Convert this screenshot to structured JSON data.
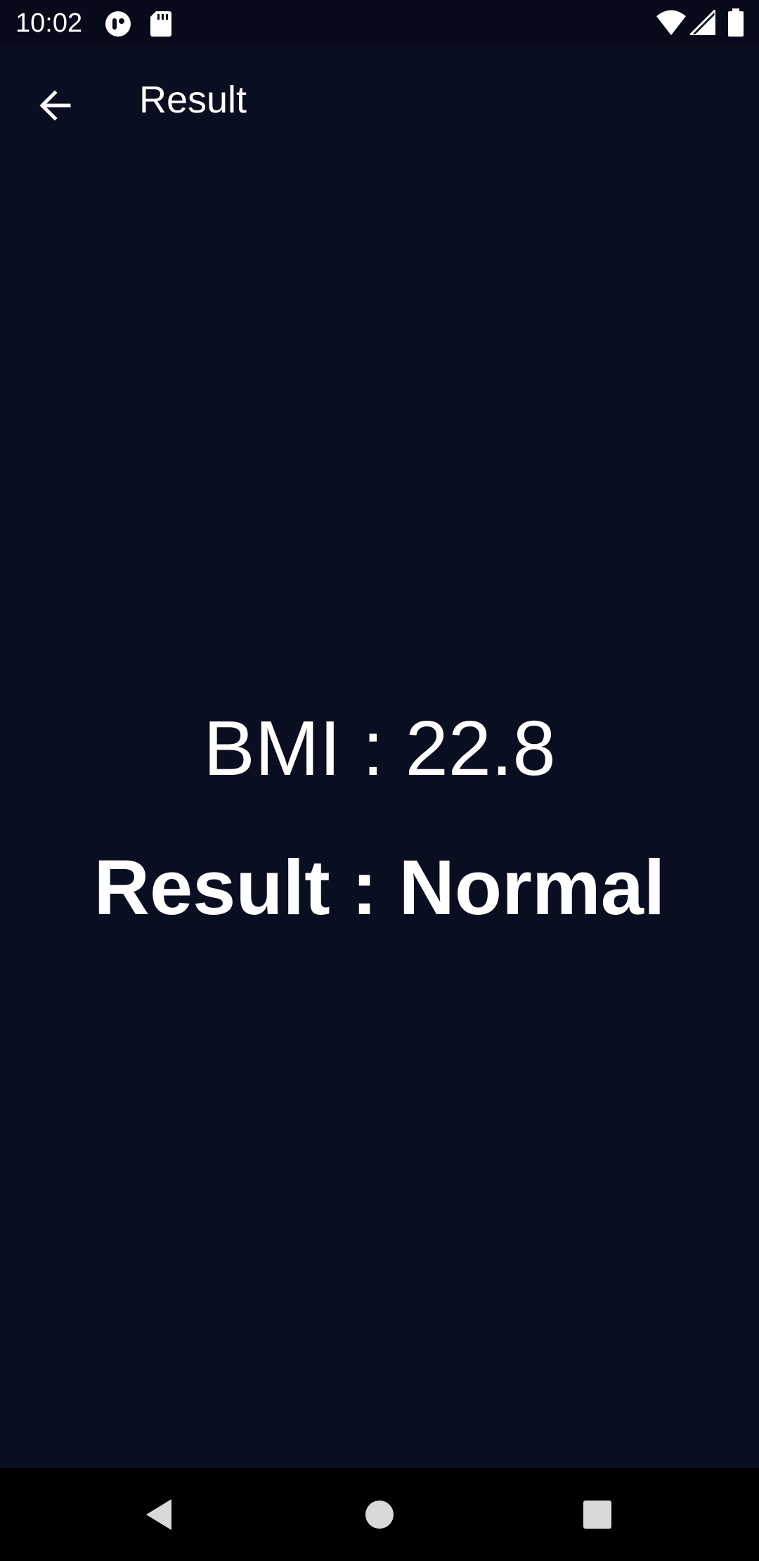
{
  "status_bar": {
    "time": "10:02",
    "icons": [
      "notification-app-icon",
      "sd-card-icon",
      "wifi-icon",
      "signal-icon",
      "battery-icon"
    ]
  },
  "app_bar": {
    "back_icon": "arrow-back-icon",
    "title": "Result"
  },
  "result": {
    "bmi_text": "BMI : 22.8",
    "result_text": "Result : Normal"
  },
  "nav_bar": {
    "icons": [
      "back-triangle-icon",
      "home-circle-icon",
      "recents-square-icon"
    ]
  },
  "colors": {
    "background": "#0a0e21",
    "status_bar": "#070a18",
    "nav_bar": "#000000",
    "text": "#ffffff"
  }
}
